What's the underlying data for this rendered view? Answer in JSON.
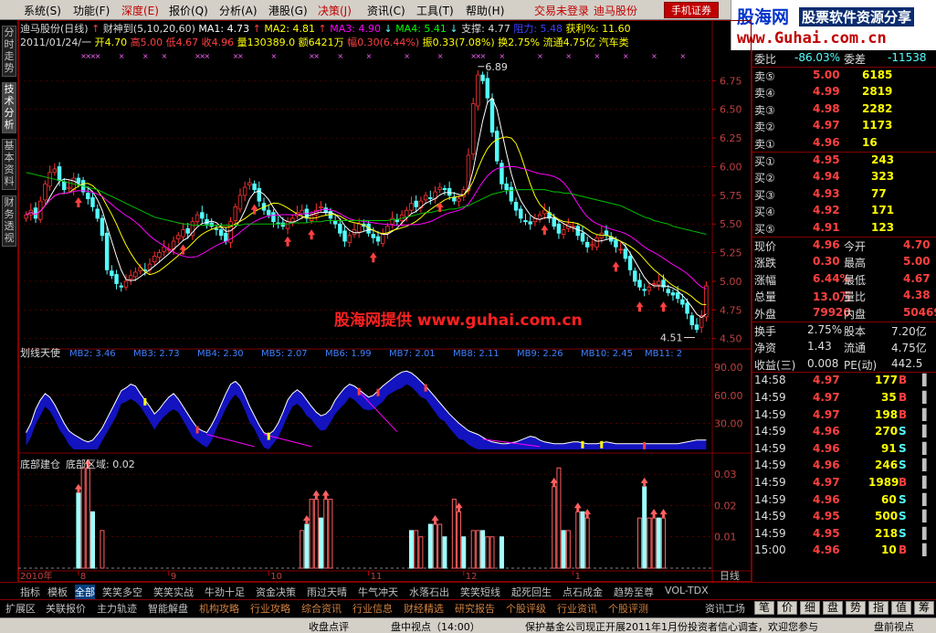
{
  "menubar": {
    "items": [
      "系统(S)",
      "功能(F)",
      "深度(E)",
      "报价(Q)",
      "分析(A)",
      "港股(G)",
      "决策(J)",
      "资讯(C)",
      "工具(T)",
      "帮助(H)"
    ],
    "trade_status": "交易未登录",
    "stock_name": "迪马股份",
    "mobile_btn": "手机证券"
  },
  "logo": {
    "big": "股海网",
    "sub": "股票软件资源分享",
    "url": "www.Guhai.com.cn"
  },
  "left_tabs": [
    "分时走势",
    "技术分析",
    "基本资料",
    "财务透视"
  ],
  "chart_header": {
    "line1_name": "迪马股份(日线)",
    "line1_ind": "财神到(5,10,20,60)",
    "ma1": "MA1: 4.73",
    "ma2": "MA2: 4.81",
    "ma3": "MA3: 4.90",
    "ma4": "MA4: 5.41",
    "support": "支撑: 4.77",
    "pressure": "阻力: 5.48",
    "profit": "获利%: 11.60",
    "line2_date": "2011/01/24/一",
    "line2_open": "开4.70",
    "line2_high": "高5.00",
    "line2_low": "低4.67",
    "line2_close": "收4.96",
    "line2_vol": "量130389.0",
    "line2_amt": "额6421万",
    "line2_chg": "幅0.30(6.44%)",
    "line2_amp": "振0.33(7.08%)",
    "line2_turn": "换2.75%",
    "line2_float": "流通4.75亿",
    "line2_sector": "汽车类"
  },
  "panel2_header": {
    "name": "划线天使",
    "items": [
      "MB2: 3.46",
      "MB3: 2.73",
      "MB4: 2.30",
      "MB5: 2.07",
      "MB6: 1.99",
      "MB7: 2.01",
      "MB8: 2.11",
      "MB9: 2.26",
      "MB10: 2.45",
      "MB11: 2"
    ]
  },
  "panel3_header": {
    "name": "底部建仓",
    "label": "底部区域: 0.02"
  },
  "watermark": "股海网提供  www.guhai.com.cn",
  "annotations": {
    "high": "6.89",
    "low": "4.51"
  },
  "xaxis": {
    "year": "2010年",
    "months": [
      "7",
      "8",
      "9",
      "10",
      "11",
      "12",
      "1"
    ],
    "period": "日线"
  },
  "quote_panel": {
    "weibi": {
      "label": "委比",
      "value": "-86.03%",
      "label2": "委差",
      "value2": "-11538"
    },
    "asks": [
      {
        "label": "卖⑤",
        "price": "5.00",
        "vol": "6185"
      },
      {
        "label": "卖④",
        "price": "4.99",
        "vol": "2819"
      },
      {
        "label": "卖③",
        "price": "4.98",
        "vol": "2282"
      },
      {
        "label": "卖②",
        "price": "4.97",
        "vol": "1173"
      },
      {
        "label": "卖①",
        "price": "4.96",
        "vol": "16"
      }
    ],
    "bids": [
      {
        "label": "买①",
        "price": "4.95",
        "vol": "243"
      },
      {
        "label": "买②",
        "price": "4.94",
        "vol": "323"
      },
      {
        "label": "买③",
        "price": "4.93",
        "vol": "77"
      },
      {
        "label": "买④",
        "price": "4.92",
        "vol": "171"
      },
      {
        "label": "买⑤",
        "price": "4.91",
        "vol": "123"
      }
    ],
    "stats": [
      {
        "l1": "现价",
        "v1": "4.96",
        "l2": "今开",
        "v2": "4.70"
      },
      {
        "l1": "涨跌",
        "v1": "0.30",
        "l2": "最高",
        "v2": "5.00"
      },
      {
        "l1": "涨幅",
        "v1": "6.44%",
        "l2": "最低",
        "v2": "4.67"
      },
      {
        "l1": "总量",
        "v1": "13.0万",
        "l2": "量比",
        "v2": "4.38"
      },
      {
        "l1": "外盘",
        "v1": "79920",
        "l2": "内盘",
        "v2": "50469"
      }
    ],
    "stats2": [
      {
        "l1": "换手",
        "v1": "2.75%",
        "l2": "股本",
        "v2": "7.20亿"
      },
      {
        "l1": "净资",
        "v1": "1.43",
        "l2": "流通",
        "v2": "4.75亿"
      },
      {
        "l1": "收益(三)",
        "v1": "0.008",
        "l2": "PE(动)",
        "v2": "442.5"
      }
    ],
    "ticks": [
      {
        "t": "14:58",
        "p": "4.97",
        "v": "177",
        "s": "B"
      },
      {
        "t": "14:59",
        "p": "4.97",
        "v": "35",
        "s": "B"
      },
      {
        "t": "14:59",
        "p": "4.97",
        "v": "198",
        "s": "B"
      },
      {
        "t": "14:59",
        "p": "4.96",
        "v": "270",
        "s": "S"
      },
      {
        "t": "14:59",
        "p": "4.96",
        "v": "91",
        "s": "S"
      },
      {
        "t": "14:59",
        "p": "4.96",
        "v": "246",
        "s": "S"
      },
      {
        "t": "14:59",
        "p": "4.97",
        "v": "1989",
        "s": "B"
      },
      {
        "t": "14:59",
        "p": "4.96",
        "v": "60",
        "s": "S"
      },
      {
        "t": "14:59",
        "p": "4.95",
        "v": "500",
        "s": "S"
      },
      {
        "t": "14:59",
        "p": "4.95",
        "v": "218",
        "s": "S"
      },
      {
        "t": "15:00",
        "p": "4.96",
        "v": "10",
        "s": "B"
      }
    ]
  },
  "bottom_tabs": [
    "指标",
    "模板",
    "全部",
    "笑笑多空",
    "笑笑实战",
    "牛劲十足",
    "资金决策",
    "雨过天晴",
    "牛气冲天",
    "水落石出",
    "笑笑短线",
    "起死回生",
    "点石成金",
    "趋势至尊",
    "VOL-TDX"
  ],
  "bottom_tabs2": [
    "扩展区",
    "关联报价",
    "主力轨迹",
    "智能解盘",
    "机构攻略",
    "行业攻略",
    "综合资讯",
    "行业信息",
    "财经精选",
    "研究报告",
    "个股评级",
    "行业资讯",
    "个股评测"
  ],
  "bottom_right": "资讯工场",
  "side_tabs": [
    "笔",
    "价",
    "细",
    "盘",
    "势",
    "指",
    "值",
    "筹"
  ],
  "statusbar": [
    "收盘点评",
    "盘中视点（14:00）",
    "保护基金公司现正开展2011年1月份投资者信心调查，欢迎您参与",
    "盘前视点"
  ],
  "colors": {
    "up": "#ff3232",
    "down": "#54fcfc",
    "ma1": "#ffffff",
    "ma2": "#ffff00",
    "ma3": "#ff00ff",
    "ma4": "#00c000"
  },
  "chart_data": {
    "type": "candlestick",
    "price_axis": {
      "ticks": [
        "6.75",
        "6.50",
        "6.25",
        "6.00",
        "5.75",
        "5.50",
        "5.25",
        "5.00",
        "4.75",
        "4.50"
      ],
      "ylim": [
        4.45,
        7.0
      ]
    },
    "ind_axis": {
      "ticks": [
        "90.00",
        "60.00",
        "30.00"
      ],
      "ylim": [
        0,
        100
      ]
    },
    "bot_axis": {
      "ticks": [
        "0.03",
        "0.02",
        "0.01"
      ],
      "ylim": [
        0,
        0.035
      ]
    },
    "close": [
      5.58,
      5.62,
      5.55,
      5.7,
      5.85,
      5.95,
      5.98,
      5.88,
      5.8,
      5.82,
      5.9,
      5.86,
      5.78,
      5.72,
      5.65,
      5.55,
      5.4,
      5.1,
      5.05,
      4.98,
      4.95,
      5.0,
      5.05,
      5.08,
      5.12,
      5.1,
      5.15,
      5.22,
      5.25,
      5.3,
      5.28,
      5.35,
      5.4,
      5.45,
      5.42,
      5.52,
      5.58,
      5.55,
      5.5,
      5.48,
      5.45,
      5.4,
      5.35,
      5.52,
      5.65,
      5.75,
      5.82,
      5.86,
      5.8,
      5.7,
      5.62,
      5.58,
      5.52,
      5.5,
      5.48,
      5.52,
      5.55,
      5.6,
      5.62,
      5.55,
      5.58,
      5.62,
      5.65,
      5.6,
      5.55,
      5.5,
      5.42,
      5.35,
      5.4,
      5.45,
      5.5,
      5.48,
      5.42,
      5.38,
      5.35,
      5.42,
      5.48,
      5.55,
      5.52,
      5.58,
      5.62,
      5.68,
      5.65,
      5.7,
      5.75,
      5.72,
      5.78,
      5.82,
      5.8,
      5.75,
      5.7,
      5.72,
      5.8,
      6.1,
      6.55,
      6.8,
      6.75,
      6.6,
      6.3,
      6.05,
      5.85,
      5.8,
      5.7,
      5.62,
      5.55,
      5.52,
      5.5,
      5.55,
      5.58,
      5.62,
      5.55,
      5.48,
      5.42,
      5.45,
      5.5,
      5.48,
      5.4,
      5.35,
      5.3,
      5.32,
      5.38,
      5.42,
      5.4,
      5.35,
      5.3,
      5.28,
      5.2,
      5.1,
      5.0,
      4.95,
      4.92,
      4.95,
      4.98,
      5.0,
      4.95,
      4.9,
      4.88,
      4.85,
      4.8,
      4.72,
      4.62,
      4.58,
      4.7,
      4.96
    ],
    "ma4": [
      5.95,
      5.94,
      5.93,
      5.92,
      5.91,
      5.9,
      5.89,
      5.88,
      5.87,
      5.86,
      5.85,
      5.84,
      5.83,
      5.82,
      5.81,
      5.8,
      5.78,
      5.76,
      5.74,
      5.72,
      5.7,
      5.68,
      5.66,
      5.64,
      5.62,
      5.6,
      5.58,
      5.56,
      5.55,
      5.54,
      5.53,
      5.52,
      5.51,
      5.5,
      5.5,
      5.49,
      5.49,
      5.49,
      5.49,
      5.49,
      5.49,
      5.49,
      5.49,
      5.49,
      5.49,
      5.49,
      5.5,
      5.5,
      5.5,
      5.5,
      5.5,
      5.5,
      5.5,
      5.5,
      5.5,
      5.5,
      5.51,
      5.51,
      5.51,
      5.51,
      5.52,
      5.52,
      5.52,
      5.53,
      5.53,
      5.53,
      5.53,
      5.53,
      5.53,
      5.53,
      5.53,
      5.53,
      5.53,
      5.53,
      5.53,
      5.53,
      5.53,
      5.54,
      5.54,
      5.55,
      5.56,
      5.57,
      5.58,
      5.59,
      5.6,
      5.6,
      5.61,
      5.62,
      5.62,
      5.63,
      5.63,
      5.64,
      5.65,
      5.66,
      5.68,
      5.7,
      5.72,
      5.74,
      5.76,
      5.77,
      5.78,
      5.79,
      5.79,
      5.8,
      5.8,
      5.8,
      5.8,
      5.8,
      5.8,
      5.8,
      5.79,
      5.78,
      5.78,
      5.77,
      5.77,
      5.76,
      5.75,
      5.74,
      5.73,
      5.72,
      5.71,
      5.7,
      5.69,
      5.68,
      5.67,
      5.66,
      5.64,
      5.62,
      5.6,
      5.58,
      5.56,
      5.55,
      5.53,
      5.52,
      5.51,
      5.5,
      5.48,
      5.47,
      5.46,
      5.45,
      5.44,
      5.43,
      5.42,
      5.41
    ],
    "ind_series": [
      20,
      30,
      45,
      55,
      62,
      58,
      50,
      40,
      30,
      22,
      18,
      15,
      12,
      10,
      12,
      18,
      25,
      35,
      45,
      55,
      65,
      68,
      72,
      70,
      62,
      55,
      48,
      40,
      45,
      52,
      58,
      62,
      56,
      48,
      40,
      32,
      25,
      22,
      20,
      28,
      38,
      50,
      62,
      72,
      75,
      70,
      60,
      48,
      38,
      28,
      20,
      18,
      22,
      30,
      42,
      55,
      62,
      66,
      62,
      55,
      48,
      42,
      38,
      40,
      45,
      55,
      62,
      68,
      72,
      70,
      66,
      62,
      58,
      60,
      65,
      70,
      74,
      78,
      82,
      85,
      86,
      84,
      80,
      75,
      70,
      64,
      58,
      52,
      46,
      40,
      35,
      30,
      26,
      22,
      20,
      18,
      15,
      12,
      10,
      9,
      8,
      8,
      9,
      10,
      12,
      14,
      16,
      15,
      12,
      10,
      9,
      8,
      8,
      8,
      9,
      10,
      10,
      9,
      8,
      8,
      8,
      9,
      10,
      9,
      8,
      8,
      8,
      8,
      8,
      8,
      8,
      8,
      8,
      8,
      8,
      8,
      8,
      8,
      9,
      10,
      11,
      12,
      12,
      12
    ],
    "bottom_bars": [
      {
        "i": 11,
        "v": 0.024
      },
      {
        "i": 12,
        "v": 0.032
      },
      {
        "i": 13,
        "v": 0.032
      },
      {
        "i": 14,
        "v": 0.018
      },
      {
        "i": 16,
        "v": 0.012
      },
      {
        "i": 58,
        "v": 0.012
      },
      {
        "i": 59,
        "v": 0.014
      },
      {
        "i": 60,
        "v": 0.022
      },
      {
        "i": 61,
        "v": 0.022
      },
      {
        "i": 62,
        "v": 0.016
      },
      {
        "i": 63,
        "v": 0.022
      },
      {
        "i": 64,
        "v": 0.022
      },
      {
        "i": 81,
        "v": 0.012
      },
      {
        "i": 82,
        "v": 0.012
      },
      {
        "i": 83,
        "v": 0.01
      },
      {
        "i": 85,
        "v": 0.014
      },
      {
        "i": 86,
        "v": 0.014
      },
      {
        "i": 87,
        "v": 0.014
      },
      {
        "i": 88,
        "v": 0.01
      },
      {
        "i": 90,
        "v": 0.022
      },
      {
        "i": 91,
        "v": 0.018
      },
      {
        "i": 92,
        "v": 0.01
      },
      {
        "i": 94,
        "v": 0.012
      },
      {
        "i": 95,
        "v": 0.012
      },
      {
        "i": 96,
        "v": 0.012
      },
      {
        "i": 97,
        "v": 0.01
      },
      {
        "i": 98,
        "v": 0.01
      },
      {
        "i": 100,
        "v": 0.01
      },
      {
        "i": 111,
        "v": 0.026
      },
      {
        "i": 112,
        "v": 0.032
      },
      {
        "i": 113,
        "v": 0.012
      },
      {
        "i": 114,
        "v": 0.012
      },
      {
        "i": 116,
        "v": 0.018
      },
      {
        "i": 117,
        "v": 0.018
      },
      {
        "i": 118,
        "v": 0.016
      },
      {
        "i": 129,
        "v": 0.016
      },
      {
        "i": 130,
        "v": 0.026
      },
      {
        "i": 131,
        "v": 0.016
      },
      {
        "i": 132,
        "v": 0.016
      },
      {
        "i": 133,
        "v": 0.016
      },
      {
        "i": 134,
        "v": 0.016
      }
    ],
    "price_arrows": [
      11,
      33,
      48,
      55,
      60,
      73,
      87,
      109,
      124,
      129,
      134
    ],
    "month_ticks": [
      11,
      30,
      51,
      72,
      92,
      115
    ]
  }
}
